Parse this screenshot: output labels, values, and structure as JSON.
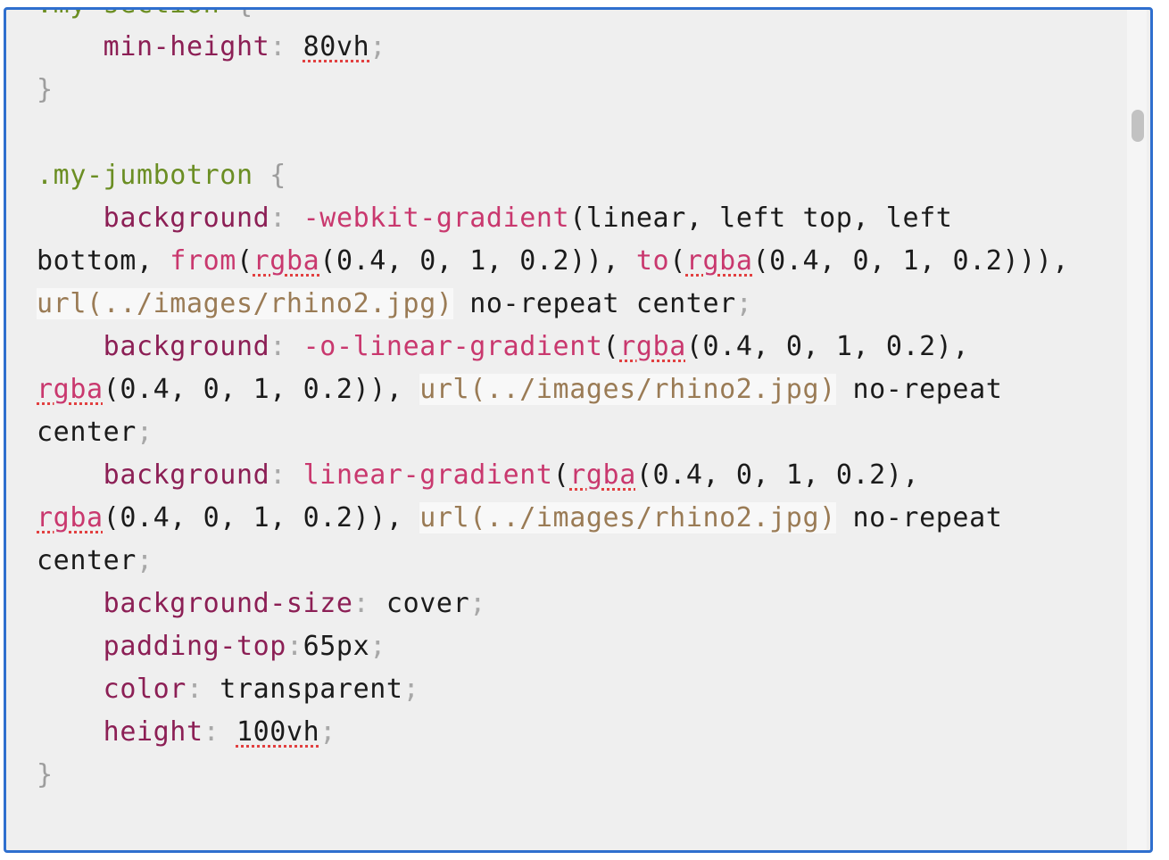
{
  "colors": {
    "border": "#2f6fce",
    "editor_background": "#efefef",
    "selector": "#6b8e23",
    "property": "#8c1f55",
    "function": "#c9386e",
    "url": "#9a7b55",
    "punctuation": "#a8a8a8",
    "text": "#1b1b1b",
    "spellcheck_underline": "#e24040"
  },
  "lines": [
    ".my-section {",
    "    min-height: 80vh;",
    "}",
    "",
    ".my-jumbotron {",
    "    background: -webkit-gradient(linear, left top, left",
    "bottom, from(rgba(0.4, 0, 1, 0.2)), to(rgba(0.4, 0, 1, 0.2))),",
    "url(../images/rhino2.jpg) no-repeat center;",
    "    background: -o-linear-gradient(rgba(0.4, 0, 1, 0.2),",
    "rgba(0.4, 0, 1, 0.2)), url(../images/rhino2.jpg) no-repeat",
    "center;",
    "    background: linear-gradient(rgba(0.4, 0, 1, 0.2),",
    "rgba(0.4, 0, 1, 0.2)), url(../images/rhino2.jpg) no-repeat",
    "center;",
    "    background-size: cover;",
    "    padding-top:65px;",
    "    color: transparent;",
    "    height: 100vh;",
    "}"
  ]
}
